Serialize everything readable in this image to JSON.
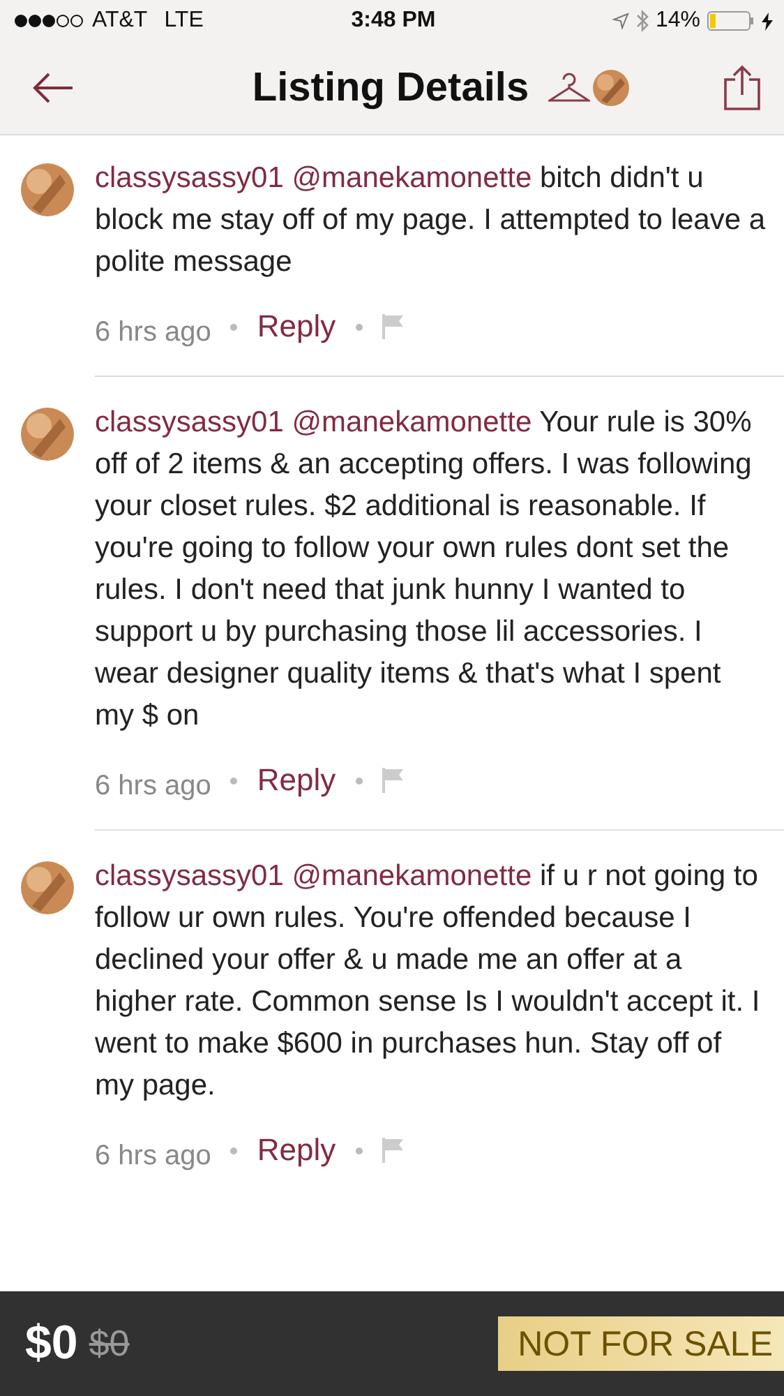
{
  "status_bar": {
    "carrier": "AT&T",
    "network": "LTE",
    "time": "3:48 PM",
    "battery": "14%"
  },
  "nav": {
    "title": "Listing Details"
  },
  "comments": [
    {
      "username": "classysassy01",
      "mention": "@manekamonette",
      "text": "bitch didn't u block me stay off of my page. I attempted to leave a polite message",
      "time": "6 hrs ago",
      "reply": "Reply"
    },
    {
      "username": "classysassy01",
      "mention": "@manekamonette",
      "text": "Your rule is 30% off of 2 items & an accepting offers. I was following your closet rules. $2 additional is reasonable. If you're going to follow your own rules dont set the rules. I don't need that junk hunny I wanted to support u by purchasing those lil accessories. I wear designer quality items & that's what I spent my $ on",
      "time": "6 hrs ago",
      "reply": "Reply"
    },
    {
      "username": "classysassy01",
      "mention": "@manekamonette",
      "text": "if u r not going to follow ur own rules. You're offended because I declined your offer & u made me an offer at a higher rate. Common sense Is I wouldn't accept it. I went to make $600 in purchases hun. Stay off of my page.",
      "time": "6 hrs ago",
      "reply": "Reply"
    }
  ],
  "footer": {
    "price": "$0",
    "original_price": "$0",
    "badge": "NOT FOR SALE"
  }
}
